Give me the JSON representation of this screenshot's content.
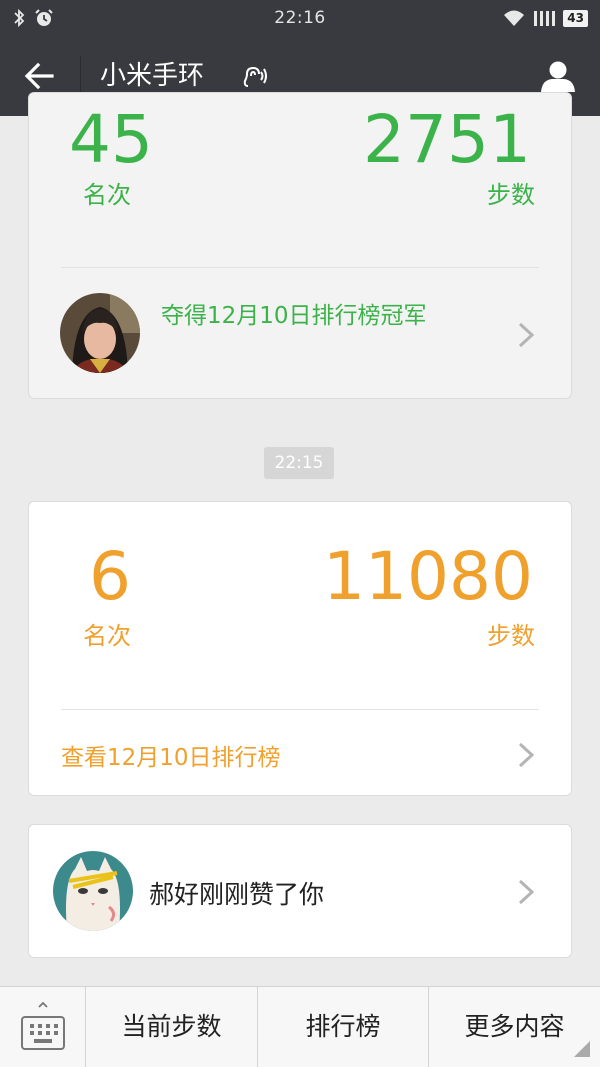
{
  "status_bar": {
    "time": "22:16",
    "battery": "43",
    "icons": [
      "bluetooth-icon",
      "alarm-icon",
      "wifi-icon",
      "signal-icon",
      "battery-icon"
    ]
  },
  "header": {
    "title": "小米手环",
    "icons": [
      "back-arrow-icon",
      "ear-icon",
      "profile-icon"
    ]
  },
  "card_top": {
    "rank": "45",
    "rank_label": "名次",
    "steps": "2751",
    "steps_label": "步数",
    "champion_text": "夺得12月10日排行榜冠军"
  },
  "timestamp": "22:15",
  "card_mid": {
    "rank": "6",
    "rank_label": "名次",
    "steps": "11080",
    "steps_label": "步数",
    "link_text": "查看12月10日排行榜"
  },
  "card_like": {
    "text": "郝好刚刚赞了你"
  },
  "bottom_menu": {
    "items": [
      "当前步数",
      "排行榜",
      "更多内容"
    ]
  },
  "colors": {
    "green": "#3cb34a",
    "orange": "#f0a02d",
    "header_bg": "#393a3f"
  }
}
